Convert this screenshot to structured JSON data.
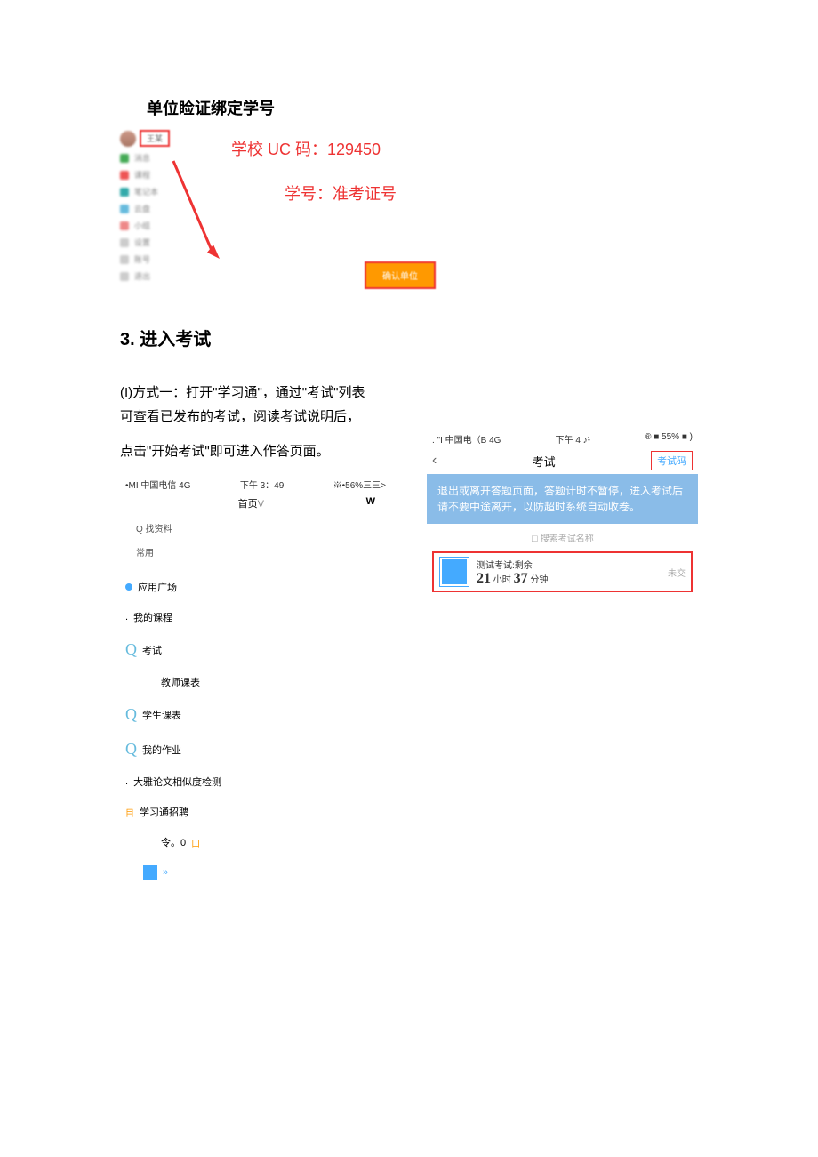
{
  "section1": {
    "title": "单位睑证绑定学号",
    "uc_label": "学校 UC 码：",
    "uc_code": "129450",
    "sid_label": "学号：",
    "sid_value": "准考证号",
    "orange_btn": "确认单位",
    "name": "王某"
  },
  "section3": {
    "heading_num": "3.",
    "heading": "进入考试",
    "para1_a": "(I)方式一：打开\"学习通\"，通过\"考试\"列表",
    "para1_b": "可查看已发布的考试，阅读考试说明后，",
    "para2": "点击\"开始考试\"即可进入作答页面。"
  },
  "phoneA": {
    "status_left": "•MI 中国电信 4G",
    "status_mid": "下午 3：49",
    "status_right": "※•56%三三>",
    "nav_home": "首页",
    "nav_v": "V",
    "nav_w": "W",
    "search": "Q 找资料",
    "common": "常用",
    "app_square": "应用广场",
    "my_course": "我的课程",
    "exam": "考试",
    "teacher_table": "教师课表",
    "student_table": "学生课表",
    "my_homework": "我的作业",
    "thesis": "大雅论文相似度检测",
    "recruit": "学习通招聘",
    "footer": "令。0"
  },
  "phoneB": {
    "status_left": ". \"I 中国电（B 4G",
    "status_mid": "下午 4 ♪¹",
    "status_right": "® ■ 55% ■ )",
    "exam_title": "考试",
    "code_btn": "考试码",
    "notice": "退出或离开答题页面，答题计时不暂停，进入考试后请不要中途离开，以防超时系统自动收卷。",
    "search": "搜索考试名称",
    "exam_name": "测试考试:剩余",
    "hours": "21",
    "hours_label": "小时",
    "minutes": "37",
    "minutes_label": "分钟",
    "status": "未交"
  }
}
